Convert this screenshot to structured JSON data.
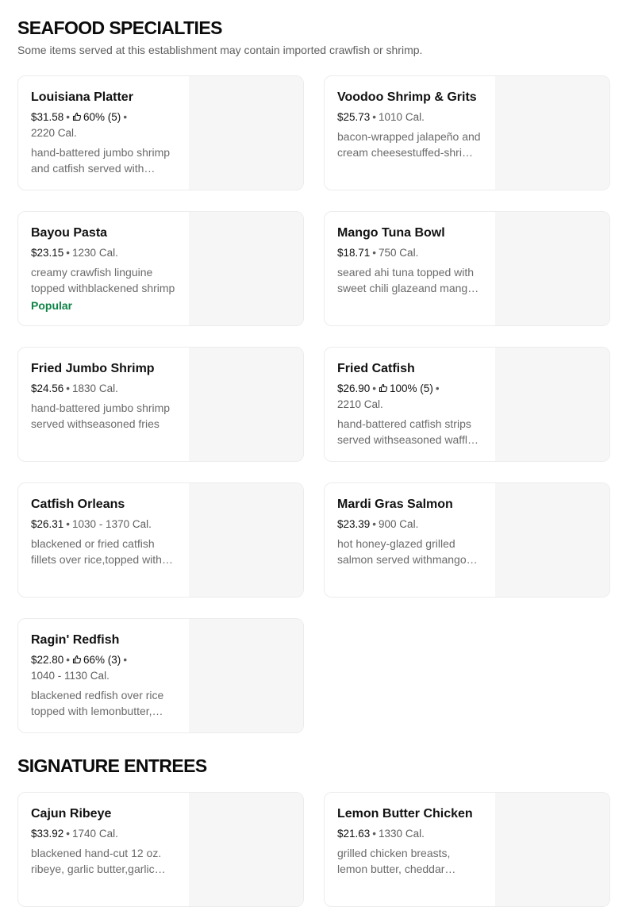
{
  "sections": [
    {
      "title": "SEAFOOD SPECIALTIES",
      "subtitle": "Some items served at this establishment may contain imported crawfish or shrimp.",
      "items": [
        {
          "name": "Louisiana Platter",
          "price": "$31.58",
          "rating": "60% (5)",
          "calories": "2220 Cal.",
          "description": "hand-battered jumbo shrimp and catfish served with seasoned fries",
          "badge": ""
        },
        {
          "name": "Voodoo Shrimp & Grits",
          "price": "$25.73",
          "rating": "",
          "calories": "1010 Cal.",
          "description": "bacon-wrapped jalapeño and cream cheesestuffed-shrimp over grits",
          "badge": ""
        },
        {
          "name": "Bayou Pasta",
          "price": "$23.15",
          "rating": "",
          "calories": "1230 Cal.",
          "description": "creamy crawfish linguine topped withblackened shrimp",
          "badge": "Popular"
        },
        {
          "name": "Mango Tuna Bowl",
          "price": "$18.71",
          "rating": "",
          "calories": "750 Cal.",
          "description": "seared ahi tuna topped with sweet chili glazeand mango salsa",
          "badge": ""
        },
        {
          "name": "Fried Jumbo Shrimp",
          "price": "$24.56",
          "rating": "",
          "calories": "1830 Cal.",
          "description": "hand-battered jumbo shrimp served withseasoned fries",
          "badge": ""
        },
        {
          "name": "Fried Catfish",
          "price": "$26.90",
          "rating": "100% (5)",
          "calories": "2210 Cal.",
          "description": "hand-battered catfish strips served withseasoned waffle fries",
          "badge": ""
        },
        {
          "name": "Catfish Orleans",
          "price": "$26.31",
          "rating": "",
          "calories": "1030 - 1370 Cal.",
          "description": "blackened or fried catfish fillets over rice,topped with crawfish sauce",
          "badge": ""
        },
        {
          "name": "Mardi Gras Salmon",
          "price": "$23.39",
          "rating": "",
          "calories": "900 Cal.",
          "description": "hot honey-glazed grilled salmon served withmango salsa",
          "badge": ""
        },
        {
          "name": "Ragin' Redfish",
          "price": "$22.80",
          "rating": "66% (3)",
          "calories": "1040 - 1130 Cal.",
          "description": "blackened redfish over rice topped with lemonbutter, shrimp",
          "badge": ""
        }
      ]
    },
    {
      "title": "SIGNATURE ENTREES",
      "subtitle": "",
      "items": [
        {
          "name": "Cajun Ribeye",
          "price": "$33.92",
          "rating": "",
          "calories": "1740 Cal.",
          "description": "blackened hand-cut 12 oz. ribeye, garlic butter,garlic mashed potatoes",
          "badge": ""
        },
        {
          "name": "Lemon Butter Chicken",
          "price": "$21.63",
          "rating": "",
          "calories": "1330 Cal.",
          "description": "grilled chicken breasts, lemon butter, cheddar mashed potatoes",
          "badge": ""
        }
      ]
    }
  ],
  "icons": {
    "rating": "thumbs-up-icon",
    "separator": "•"
  },
  "colors": {
    "badge": "#0e8345",
    "muted": "#6b6b6b",
    "thumb_bg": "#f6f6f6"
  }
}
